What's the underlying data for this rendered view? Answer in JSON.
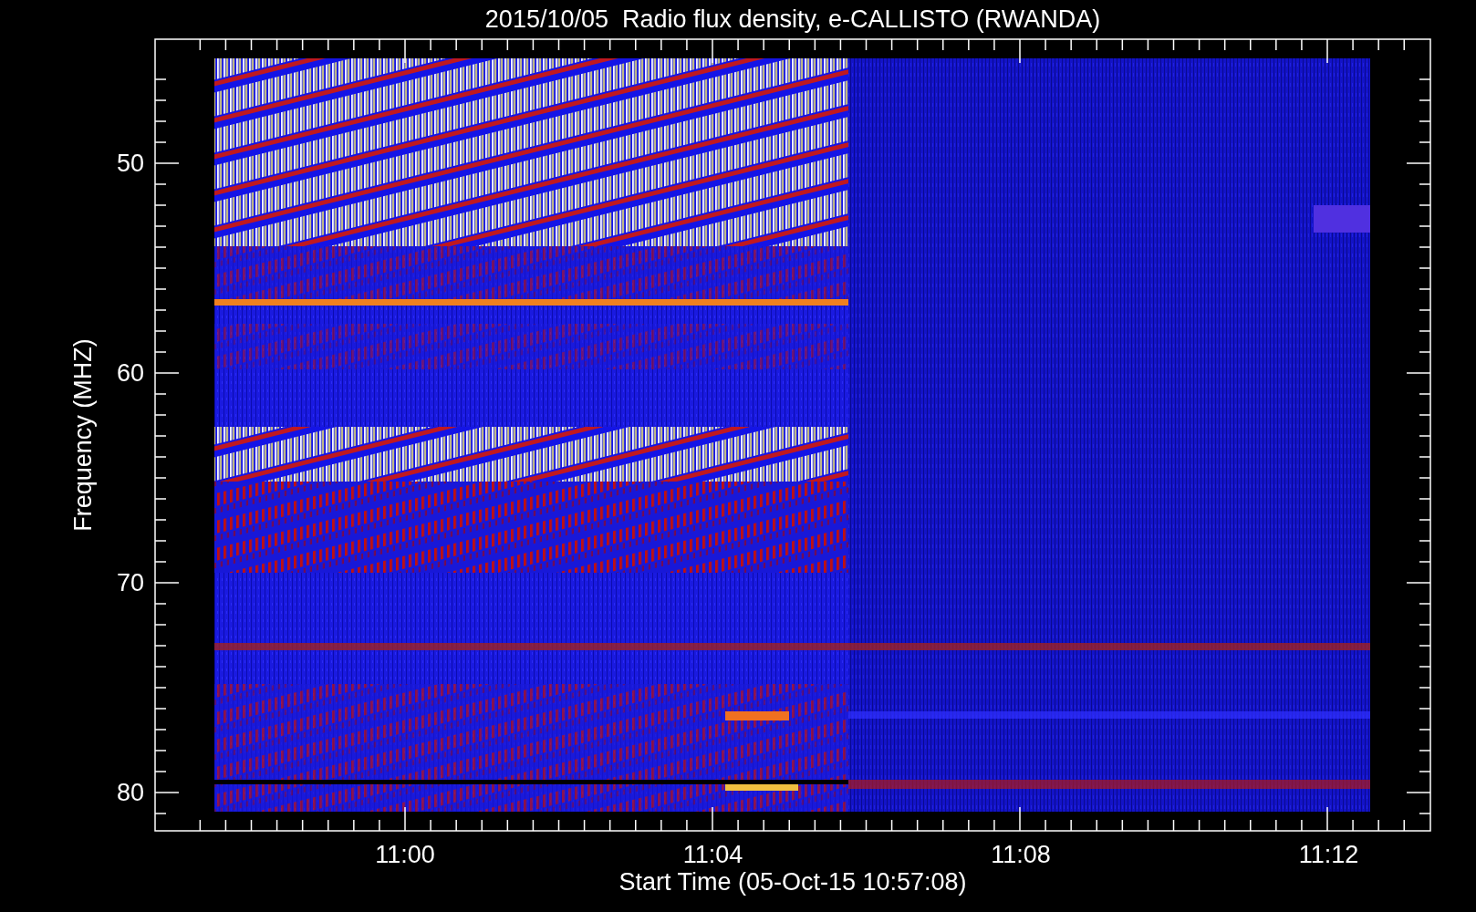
{
  "plot": {
    "title": "2015/10/05  Radio flux density, e-CALLISTO (RWANDA)",
    "y_axis": {
      "label": "Frequency (MHZ)",
      "ticks": [
        "50",
        "60",
        "70",
        "80"
      ]
    },
    "x_axis": {
      "label": "Start Time (05-Oct-15 10:57:08)",
      "ticks": [
        "11:00",
        "11:04",
        "11:08",
        "11:12"
      ]
    }
  }
}
